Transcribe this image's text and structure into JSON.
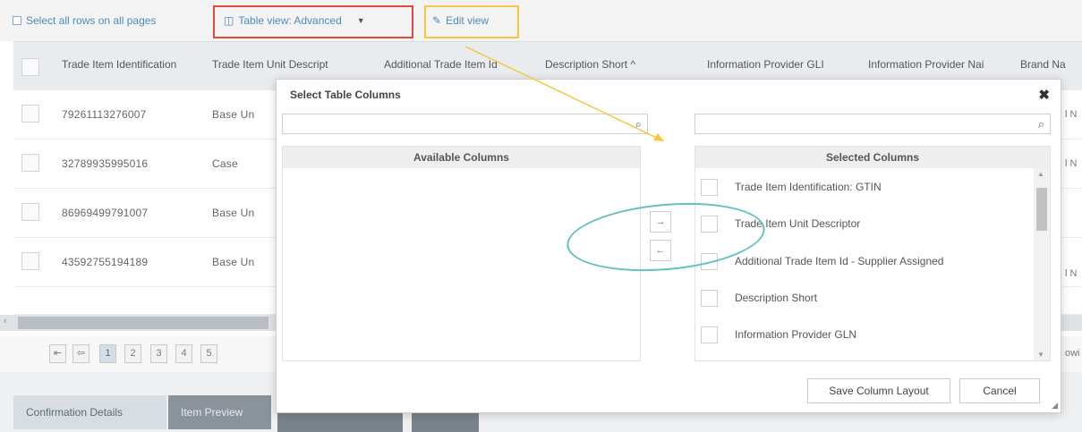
{
  "toolbar": {
    "select_all": "Select all rows on all pages",
    "table_view": "Table view: Advanced",
    "edit_view": "Edit view"
  },
  "grid": {
    "headers": [
      "Trade Item Identification",
      "Trade Item Unit Descript",
      "Additional Trade Item Id",
      "Description Short ^",
      "Information Provider GLI",
      "Information Provider Nai",
      "Brand Na"
    ],
    "rows": [
      {
        "gtin": "79261113276007",
        "unit": "Base Un"
      },
      {
        "gtin": "32789935995016",
        "unit": "Case"
      },
      {
        "gtin": "86969499791007",
        "unit": "Base Un"
      },
      {
        "gtin": "43592755194189",
        "unit": "Base Un"
      }
    ],
    "right_edge": [
      "l N",
      "l N",
      "l N"
    ],
    "pager_pages": [
      "1",
      "2",
      "3",
      "4",
      "5"
    ],
    "pager_right": "owi"
  },
  "tabs": {
    "confirmation": "Confirmation Details",
    "preview": "Item Preview"
  },
  "modal": {
    "title": "Select Table Columns",
    "close": "✖",
    "available_title": "Available Columns",
    "selected_title": "Selected Columns",
    "move_right": "→",
    "move_left": "←",
    "selected_columns": [
      "Trade Item Identification: GTIN",
      "Trade Item Unit Descriptor",
      "Additional Trade Item Id - Supplier Assigned",
      "Description Short",
      "Information Provider GLN"
    ],
    "save_button": "Save Column Layout",
    "cancel_button": "Cancel"
  },
  "colors": {
    "highlight_red": "#e04a3a",
    "highlight_yellow": "#f5c842",
    "annotation_cyan": "#5fc1c0",
    "link_blue": "#4a8bbf"
  }
}
